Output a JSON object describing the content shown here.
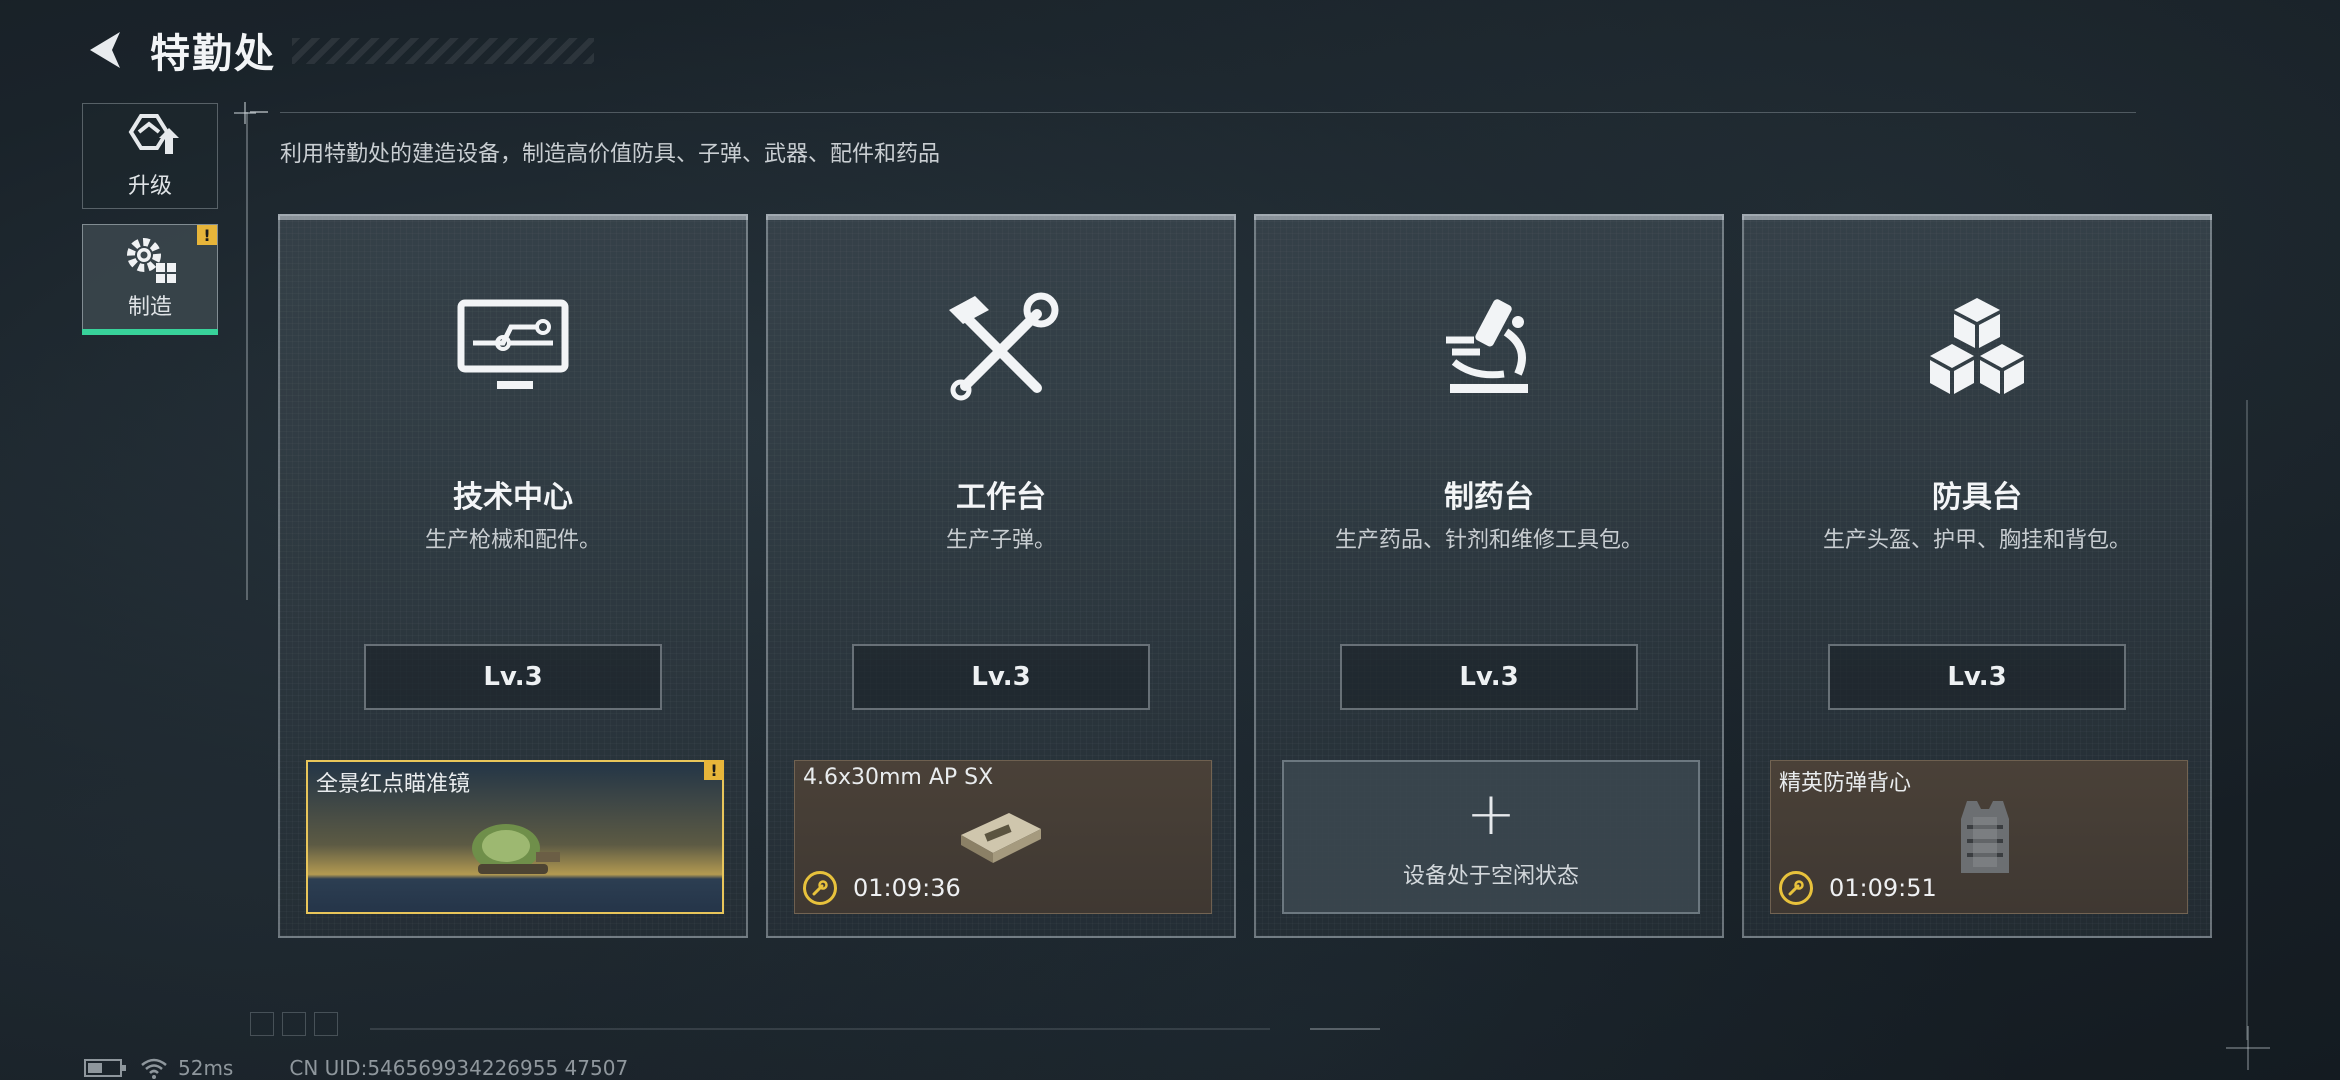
{
  "header": {
    "title": "特勤处"
  },
  "sidebar": {
    "items": [
      {
        "label": "升级",
        "icon": "upgrade-icon",
        "active": false,
        "alert": false
      },
      {
        "label": "制造",
        "icon": "gear-craft-icon",
        "active": true,
        "alert": true,
        "alert_text": "!"
      }
    ]
  },
  "description": "利用特勤处的建造设备，制造高价值防具、子弹、武器、配件和药品",
  "cards": [
    {
      "title": "技术中心",
      "subtitle": "生产枪械和配件。",
      "icon": "monitor-circuit-icon",
      "level": "Lv.3",
      "slot": {
        "state": "ready",
        "item_name": "全景红点瞄准镜",
        "alert_text": "!",
        "item_icon": "red-dot-sight-icon"
      }
    },
    {
      "title": "工作台",
      "subtitle": "生产子弹。",
      "icon": "hammer-wrench-icon",
      "level": "Lv.3",
      "slot": {
        "state": "producing",
        "item_name": "4.6x30mm AP SX",
        "timer": "01:09:36",
        "item_icon": "ammo-box-icon"
      }
    },
    {
      "title": "制药台",
      "subtitle": "生产药品、针剂和维修工具包。",
      "icon": "microscope-icon",
      "level": "Lv.3",
      "slot": {
        "state": "idle",
        "plus": "+",
        "idle_text": "设备处于空闲状态"
      }
    },
    {
      "title": "防具台",
      "subtitle": "生产头盔、护甲、胸挂和背包。",
      "icon": "boxes-icon",
      "level": "Lv.3",
      "slot": {
        "state": "producing",
        "item_name": "精英防弹背心",
        "timer": "01:09:51",
        "item_icon": "armor-vest-icon"
      }
    }
  ],
  "status_bar": {
    "ping": "52ms",
    "uid": "CN UID:546569934226955 47507"
  },
  "colors": {
    "accent_green": "#38d29a",
    "alert_yellow": "#e7b53a",
    "timer_yellow": "#e8c23c",
    "ready_border": "#e8c55a"
  }
}
